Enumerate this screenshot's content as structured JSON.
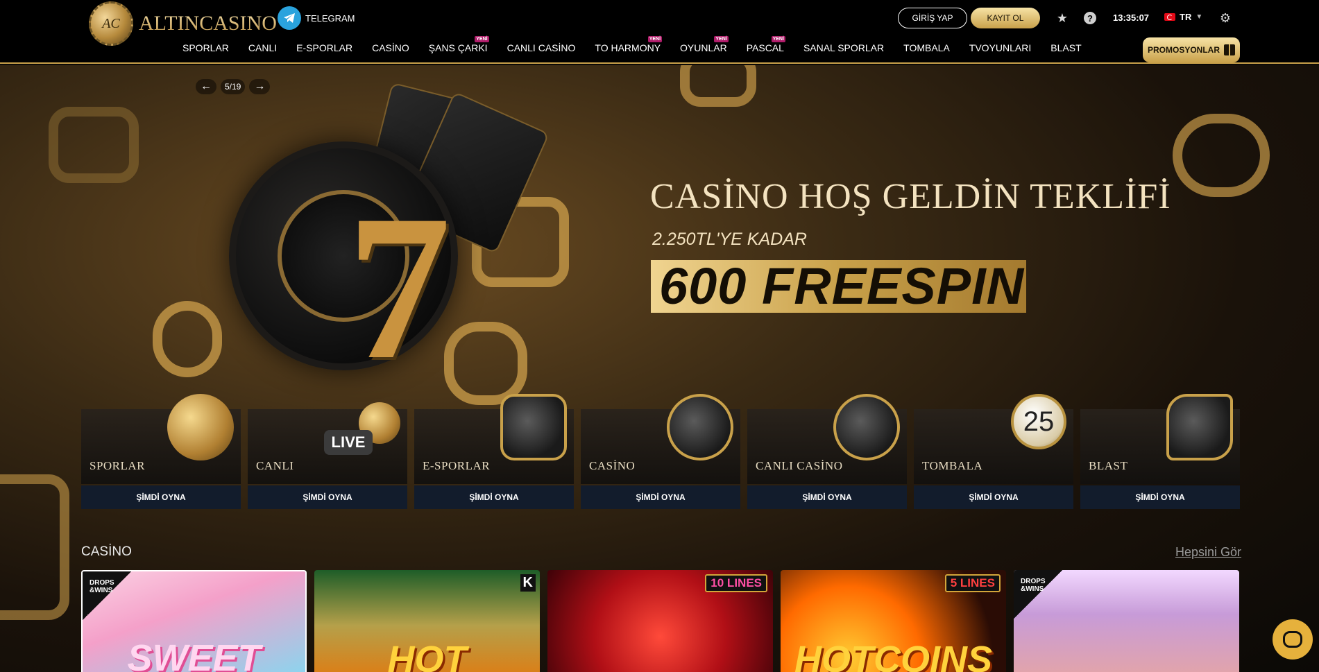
{
  "header": {
    "logo_text": "ALTINCASINO",
    "logo_monogram": "AC",
    "telegram_label": "TELEGRAM",
    "login_label": "GİRİŞ YAP",
    "register_label": "KAYIT OL",
    "clock": "13:35:07",
    "language": "TR",
    "promotions_label": "PROMOSYONLAR",
    "icons": [
      "star-icon",
      "help-icon",
      "settings-icon",
      "chevron-down-icon",
      "gift-icon",
      "telegram-icon"
    ]
  },
  "nav": {
    "new_badge": "YENİ",
    "items": [
      {
        "label": "SPORLAR",
        "is_new": false
      },
      {
        "label": "CANLI",
        "is_new": false
      },
      {
        "label": "E-SPORLAR",
        "is_new": false
      },
      {
        "label": "CASİNO",
        "is_new": false
      },
      {
        "label": "ŞANS ÇARKI",
        "is_new": true
      },
      {
        "label": "CANLI CASİNO",
        "is_new": false
      },
      {
        "label": "TO HARMONY",
        "is_new": true
      },
      {
        "label": "OYUNLAR",
        "is_new": true
      },
      {
        "label": "PASCAL",
        "is_new": true
      },
      {
        "label": "SANAL SPORLAR",
        "is_new": false
      },
      {
        "label": "TOMBALA",
        "is_new": false
      },
      {
        "label": "TVOYUNLARI",
        "is_new": false
      },
      {
        "label": "BLAST",
        "is_new": false
      }
    ]
  },
  "hero": {
    "slide_counter": "5/19",
    "title": "CASİNO HOŞ GELDİN TEKLİFİ",
    "subtitle": "2.250TL'YE KADAR",
    "highlight": "600 FREESPIN",
    "art_seven": "7"
  },
  "categories": {
    "play_label": "ŞİMDİ OYNA",
    "items": [
      {
        "name": "SPORLAR"
      },
      {
        "name": "CANLI",
        "art_text": "LIVE"
      },
      {
        "name": "E-SPORLAR"
      },
      {
        "name": "CASİNO"
      },
      {
        "name": "CANLI CASİNO"
      },
      {
        "name": "TOMBALA",
        "art_text": "25"
      },
      {
        "name": "BLAST"
      }
    ]
  },
  "casino_section": {
    "title": "CASİNO",
    "see_all": "Hepsini Gör",
    "games": [
      {
        "title": "SWEET",
        "badge": "DROPS &WINS"
      },
      {
        "title": "HOT",
        "badge": "K"
      },
      {
        "title": "",
        "badge": "10 LINES"
      },
      {
        "title": "HOTCOINS",
        "badge": "5 LINES"
      },
      {
        "title": "",
        "badge": "DROPS &WINS"
      }
    ]
  },
  "colors": {
    "gold": "#c9a14a",
    "header_bg": "#000000",
    "play_button_bg": "#121c2c",
    "new_badge": "#b01c6a",
    "telegram": "#2aa3dd",
    "chat": "#e6b13c"
  }
}
